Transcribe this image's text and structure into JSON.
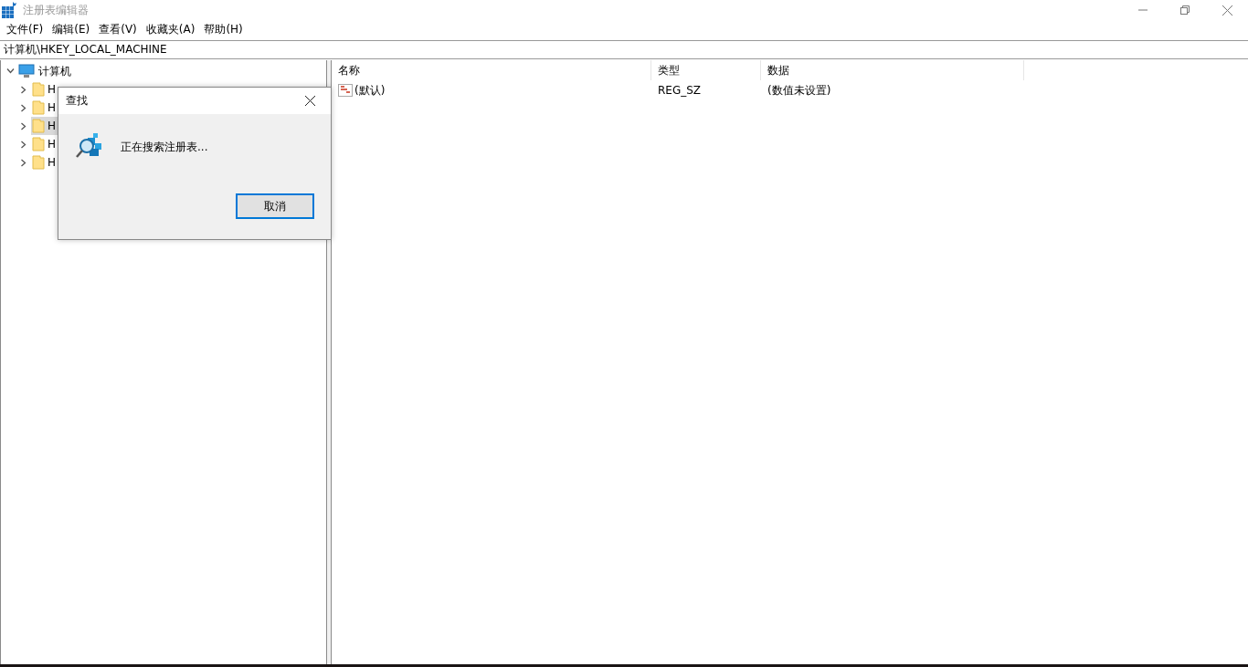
{
  "window": {
    "title": "注册表编辑器"
  },
  "menu": [
    "文件(F)",
    "编辑(E)",
    "查看(V)",
    "收藏夹(A)",
    "帮助(H)"
  ],
  "address": "计算机\\HKEY_LOCAL_MACHINE",
  "tree": {
    "label": "计算机",
    "expanded": true,
    "children": [
      {
        "label": "H",
        "selected": false
      },
      {
        "label": "H",
        "selected": false
      },
      {
        "label": "H",
        "selected": true
      },
      {
        "label": "H",
        "selected": false
      },
      {
        "label": "H",
        "selected": false
      }
    ]
  },
  "table": {
    "columns": [
      "名称",
      "类型",
      "数据"
    ],
    "rows": [
      {
        "name": "(默认)",
        "type": "REG_SZ",
        "data": "(数值未设置)"
      }
    ]
  },
  "dialog": {
    "title": "查找",
    "message": "正在搜索注册表...",
    "button": "取消"
  }
}
